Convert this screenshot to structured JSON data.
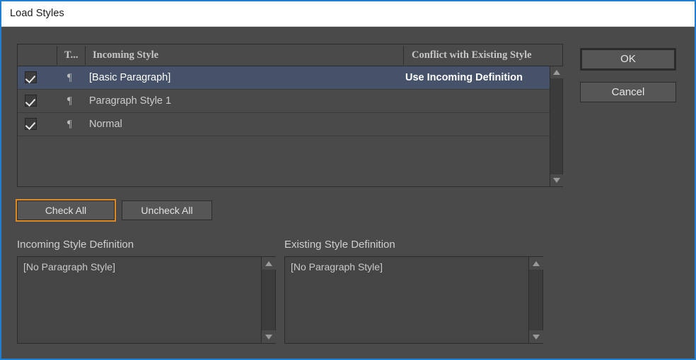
{
  "window": {
    "title": "Load Styles",
    "accent_border": "#1f7fd0",
    "body_bg": "#4a4a4a",
    "selection_bg": "#455269",
    "focus_ring": "#e08a24"
  },
  "table": {
    "columns": [
      {
        "key": "check",
        "label": ""
      },
      {
        "key": "type",
        "label": "T..."
      },
      {
        "key": "name",
        "label": "Incoming Style"
      },
      {
        "key": "conflict",
        "label": "Conflict with Existing Style"
      }
    ],
    "rows": [
      {
        "checked": true,
        "type_icon": "pilcrow-icon",
        "type_glyph": "¶",
        "name": "[Basic Paragraph]",
        "conflict": "Use Incoming Definition",
        "selected": true
      },
      {
        "checked": true,
        "type_icon": "pilcrow-icon",
        "type_glyph": "¶",
        "name": "Paragraph Style 1",
        "conflict": "",
        "selected": false
      },
      {
        "checked": true,
        "type_icon": "pilcrow-icon",
        "type_glyph": "¶",
        "name": "Normal",
        "conflict": "",
        "selected": false
      }
    ],
    "empty_row_count": 2,
    "scrollbar": {
      "up_icon": "triangle-up-icon",
      "down_icon": "triangle-down-icon"
    }
  },
  "buttons": {
    "check_all": "Check All",
    "uncheck_all": "Uncheck All",
    "ok": "OK",
    "cancel": "Cancel"
  },
  "definitions": {
    "incoming": {
      "label": "Incoming Style Definition",
      "text": "[No Paragraph Style]"
    },
    "existing": {
      "label": "Existing Style Definition",
      "text": "[No Paragraph Style]"
    },
    "scrollbar": {
      "up_icon": "triangle-up-icon",
      "down_icon": "triangle-down-icon"
    }
  }
}
